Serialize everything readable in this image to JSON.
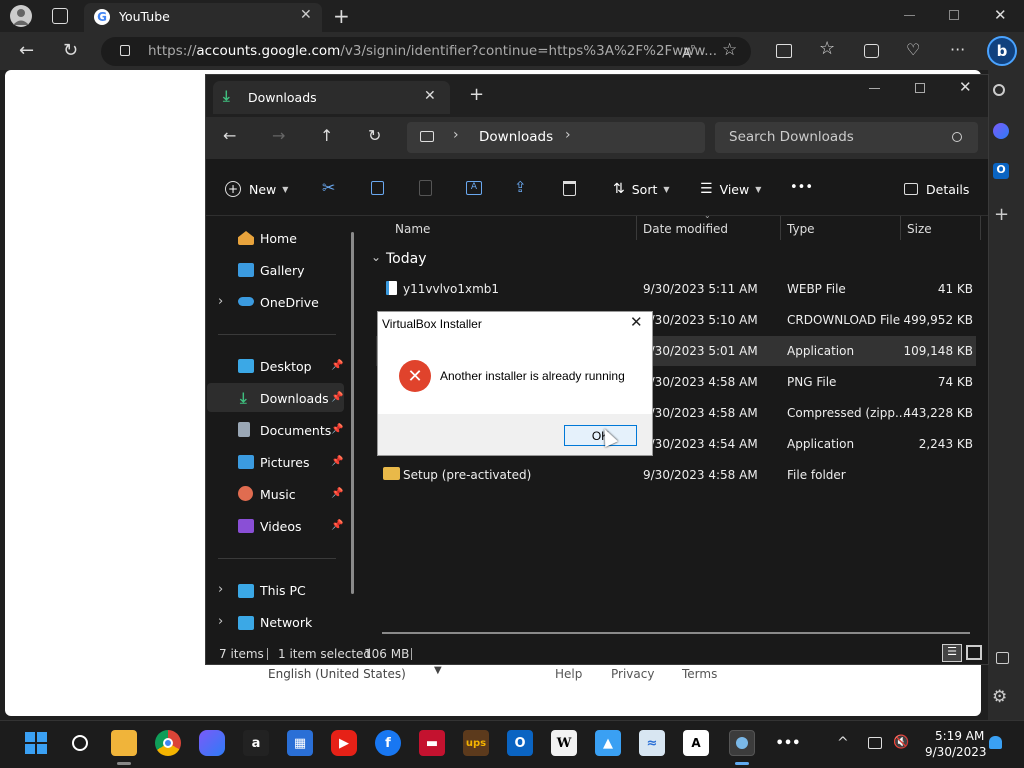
{
  "browser": {
    "tab_title": "YouTube",
    "url_host": "accounts.google.com",
    "url_prefix": "https://",
    "url_path": "/v3/signin/identifier?continue=https%3A%2F%2Fwww..."
  },
  "google_footer": {
    "language": "English (United States)",
    "links": [
      "Help",
      "Privacy",
      "Terms"
    ]
  },
  "explorer": {
    "tab_title": "Downloads",
    "breadcrumb": "Downloads",
    "search_placeholder": "Search Downloads",
    "toolbar": {
      "new": "New",
      "sort": "Sort",
      "view": "View",
      "more": "•••",
      "details": "Details"
    },
    "nav": {
      "home": "Home",
      "gallery": "Gallery",
      "onedrive": "OneDrive",
      "desktop": "Desktop",
      "downloads": "Downloads",
      "documents": "Documents",
      "pictures": "Pictures",
      "music": "Music",
      "videos": "Videos",
      "thispc": "This PC",
      "network": "Network"
    },
    "columns": {
      "name": "Name",
      "date": "Date modified",
      "type": "Type",
      "size": "Size"
    },
    "group": "Today",
    "files": [
      {
        "name": "y11vvlvo1xmb1",
        "date": "9/30/2023 5:11 AM",
        "type": "WEBP File",
        "size": "41 KB"
      },
      {
        "name": "",
        "date": "9/30/2023 5:10 AM",
        "type": "CRDOWNLOAD File",
        "size": "499,952 KB"
      },
      {
        "name": "",
        "date": "9/30/2023 5:01 AM",
        "type": "Application",
        "size": "109,148 KB"
      },
      {
        "name": "",
        "date": "9/30/2023 4:58 AM",
        "type": "PNG File",
        "size": "74 KB"
      },
      {
        "name": "",
        "date": "9/30/2023 4:58 AM",
        "type": "Compressed (zipp...",
        "size": "443,228 KB"
      },
      {
        "name": "",
        "date": "9/30/2023 4:54 AM",
        "type": "Application",
        "size": "2,243 KB"
      },
      {
        "name": "Setup (pre-activated)",
        "date": "9/30/2023 4:58 AM",
        "type": "File folder",
        "size": ""
      }
    ],
    "status": {
      "items": "7 items",
      "selected": "1 item selected",
      "selected_size": "106 MB"
    }
  },
  "dialog": {
    "title": "VirtualBox Installer",
    "message": "Another installer is already running",
    "ok": "OK"
  },
  "clock": {
    "time": "5:19 AM",
    "date": "9/30/2023"
  },
  "colors": {
    "accent": "#0078d4",
    "error": "#e0432c",
    "explorer_bg": "#191919"
  }
}
